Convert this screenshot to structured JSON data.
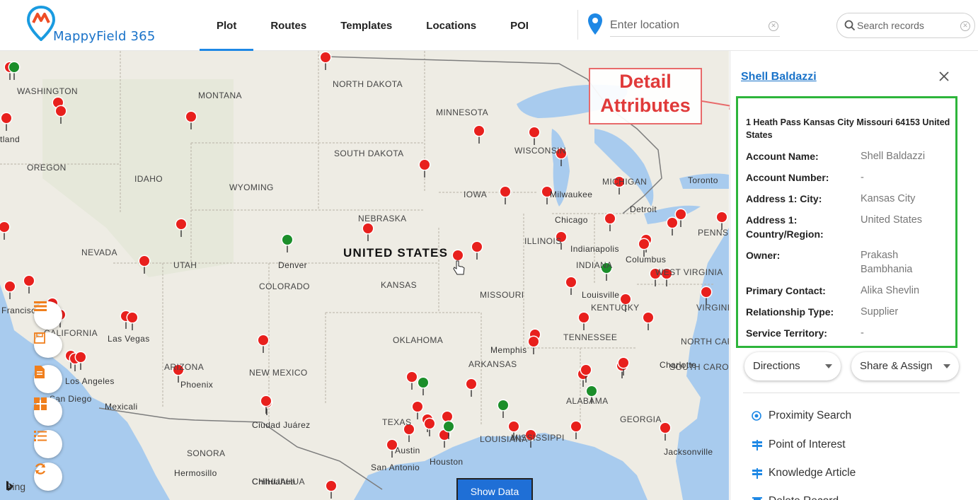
{
  "app": {
    "name": "MappyField 365"
  },
  "nav": {
    "tabs": [
      {
        "label": "Plot",
        "active": true
      },
      {
        "label": "Routes"
      },
      {
        "label": "Templates"
      },
      {
        "label": "Locations"
      },
      {
        "label": "POI"
      }
    ]
  },
  "location": {
    "placeholder": "Enter location"
  },
  "search": {
    "placeholder": "Search records"
  },
  "map": {
    "country_label": "UNITED STATES",
    "labels": [
      {
        "text": "WASHINGTON",
        "kind": "state"
      },
      {
        "text": "MONTANA",
        "kind": "state"
      },
      {
        "text": "NORTH DAKOTA",
        "kind": "state"
      },
      {
        "text": "MINNESOTA",
        "kind": "state"
      },
      {
        "text": "WISCONSIN",
        "kind": "state"
      },
      {
        "text": "MICHIGAN",
        "kind": "state"
      },
      {
        "text": "OREGON",
        "kind": "state"
      },
      {
        "text": "IDAHO",
        "kind": "state"
      },
      {
        "text": "SOUTH DAKOTA",
        "kind": "state"
      },
      {
        "text": "WYOMING",
        "kind": "state"
      },
      {
        "text": "IOWA",
        "kind": "state"
      },
      {
        "text": "NEBRASKA",
        "kind": "state"
      },
      {
        "text": "NEVADA",
        "kind": "state"
      },
      {
        "text": "UTAH",
        "kind": "state"
      },
      {
        "text": "COLORADO",
        "kind": "state"
      },
      {
        "text": "KANSAS",
        "kind": "state"
      },
      {
        "text": "ILLINOIS",
        "kind": "state"
      },
      {
        "text": "INDIANA",
        "kind": "state"
      },
      {
        "text": "MISSOURI",
        "kind": "state"
      },
      {
        "text": "KENTUCKY",
        "kind": "state"
      },
      {
        "text": "CALIFORNIA",
        "kind": "state"
      },
      {
        "text": "OKLAHOMA",
        "kind": "state"
      },
      {
        "text": "TENNESSEE",
        "kind": "state"
      },
      {
        "text": "ARIZONA",
        "kind": "state"
      },
      {
        "text": "NEW MEXICO",
        "kind": "state"
      },
      {
        "text": "ARKANSAS",
        "kind": "state"
      },
      {
        "text": "TEXAS",
        "kind": "state"
      },
      {
        "text": "MISSISSIPPI",
        "kind": "state"
      },
      {
        "text": "ALABAMA",
        "kind": "state"
      },
      {
        "text": "GEORGIA",
        "kind": "state"
      },
      {
        "text": "LOUISIANA",
        "kind": "state"
      },
      {
        "text": "WEST VIRGINIA",
        "kind": "state"
      },
      {
        "text": "VIRGINI",
        "kind": "state"
      },
      {
        "text": "NORTH CAR",
        "kind": "state"
      },
      {
        "text": "SOUTH CAROLINA",
        "kind": "state"
      },
      {
        "text": "SONORA",
        "kind": "state"
      },
      {
        "text": "CHIHUAHUA",
        "kind": "state"
      },
      {
        "text": "PENNSY",
        "kind": "state"
      },
      {
        "text": "Denver",
        "kind": "city"
      },
      {
        "text": "Chicago",
        "kind": "city"
      },
      {
        "text": "Indianapolis",
        "kind": "city"
      },
      {
        "text": "Columbus",
        "kind": "city"
      },
      {
        "text": "Detroit",
        "kind": "city"
      },
      {
        "text": "Toronto",
        "kind": "city"
      },
      {
        "text": "Louisville",
        "kind": "city"
      },
      {
        "text": "Memphis",
        "kind": "city"
      },
      {
        "text": "Las Vegas",
        "kind": "city"
      },
      {
        "text": "Phoenix",
        "kind": "city"
      },
      {
        "text": "Los Angeles",
        "kind": "city"
      },
      {
        "text": "San Diego",
        "kind": "city"
      },
      {
        "text": "Mexicali",
        "kind": "city"
      },
      {
        "text": "Ciudad Juárez",
        "kind": "city"
      },
      {
        "text": "Hermosillo",
        "kind": "city"
      },
      {
        "text": "Chihuahua",
        "kind": "city"
      },
      {
        "text": "Austin",
        "kind": "city"
      },
      {
        "text": "San Antonio",
        "kind": "city"
      },
      {
        "text": "Houston",
        "kind": "city"
      },
      {
        "text": "Charlotte",
        "kind": "city"
      },
      {
        "text": "Jacksonville",
        "kind": "city"
      },
      {
        "text": "Francisco",
        "kind": "city"
      },
      {
        "text": "tland",
        "kind": "city"
      },
      {
        "text": "Milwaukee",
        "kind": "city"
      }
    ],
    "pins_red": 66,
    "pins_green": 7
  },
  "bing_label": "Bing",
  "show_data_label": "Show Data",
  "annotation": {
    "line1": "Detail",
    "line2": "Attributes",
    "color": "#e03a3a"
  },
  "panel": {
    "title": "Shell Baldazzi",
    "address": "1 Heath Pass Kansas City Missouri 64153 United States",
    "attributes": [
      {
        "label": "Account Name:",
        "value": "Shell Baldazzi"
      },
      {
        "label": "Account Number:",
        "value": "-"
      },
      {
        "label": "Address 1: City:",
        "value": "Kansas City"
      },
      {
        "label": "Address 1: Country/Region:",
        "value": "United States"
      },
      {
        "label": "Owner:",
        "value": "Prakash Bambhania"
      },
      {
        "label": "Primary Contact:",
        "value": "Alika Shevlin"
      },
      {
        "label": "Relationship Type:",
        "value": "Supplier"
      },
      {
        "label": "Service Territory:",
        "value": "-"
      }
    ],
    "directions_label": "Directions",
    "share_assign_label": "Share & Assign",
    "actions": [
      {
        "label": "Proximity Search",
        "icon": "target-icon"
      },
      {
        "label": "Point of Interest",
        "icon": "signpost-icon"
      },
      {
        "label": "Knowledge Article",
        "icon": "signpost-icon"
      },
      {
        "label": "Delete Record",
        "icon": "trash-icon"
      }
    ]
  },
  "colors": {
    "accent": "#1e88e5",
    "pin_red": "#e8201d",
    "pin_green": "#1b8e2a",
    "highlight": "#2db53b"
  }
}
